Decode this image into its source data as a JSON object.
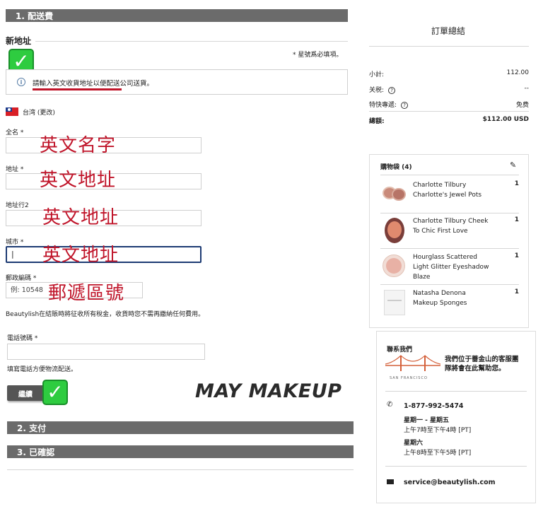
{
  "steps": {
    "step1": "1. 配送費",
    "step2": "2. 支付",
    "step3": "3. 已確認"
  },
  "address": {
    "section_title": "新地址",
    "required_note": "* 星號爲必填項。",
    "info_text": "請輸入英文收貨地址以便配送公司送貨。",
    "country": "台湾 (更改)",
    "fields": {
      "name_label": "全名 *",
      "address_label": "地址 *",
      "address2_label": "地址行2",
      "city_label": "城市 *",
      "city_value": "|",
      "zip_label": "郵政編碼 *",
      "zip_placeholder": "例: 10548"
    },
    "tax_note": "Beautylish在結賬時將征收所有稅金，收貨時您不需再繳納任何費用。",
    "phone_label": "電話號碼 *",
    "phone_hint": "填寫電話方便物流配送。",
    "continue_label": "繼續"
  },
  "annotations": {
    "name": "英文名字",
    "address": "英文地址",
    "address2": "英文地址",
    "city": "英文地址",
    "zip": "郵遞區號",
    "brand": "MAY MAKEUP"
  },
  "summary": {
    "title": "訂單總結",
    "subtotal_label": "小計:",
    "subtotal_value": "112.00",
    "tax_label": "关税:",
    "tax_value": "--",
    "shipping_label": "特快專遞:",
    "shipping_value": "免费",
    "total_label": "總額:",
    "total_value": "$112.00 USD"
  },
  "bag": {
    "title": "購物袋 (4)",
    "items": [
      {
        "name_line1": "Charlotte Tilbury",
        "name_line2": "Charlotte's Jewel Pots",
        "name_line3": "",
        "qty": "1"
      },
      {
        "name_line1": "Charlotte Tilbury Cheek",
        "name_line2": "To Chic First Love",
        "name_line3": "",
        "qty": "1"
      },
      {
        "name_line1": "Hourglass Scattered",
        "name_line2": "Light Glitter Eyeshadow",
        "name_line3": "Blaze",
        "qty": "1"
      },
      {
        "name_line1": "Natasha Denona",
        "name_line2": "Makeup Sponges",
        "name_line3": "",
        "qty": "1"
      }
    ]
  },
  "contact": {
    "title": "聯系我們",
    "desc_line1": "我們位于薔金山的客服團",
    "desc_line2": "隊將會在此幫助您。",
    "city_caption": "SAN FRANCISCO",
    "phone": "1-877-992-5474",
    "weekday_label": "星期一 - 星期五",
    "weekday_hours": "上午7時至下午4時 [PT]",
    "saturday_label": "星期六",
    "saturday_hours": "上午8時至下午5時 [PT]",
    "email": "service@beautylish.com"
  },
  "colors": {
    "step_bar": "#6b6b6b",
    "annotation": "#c0152a",
    "check": "#2ecc40",
    "bridge": "#d4603a"
  }
}
